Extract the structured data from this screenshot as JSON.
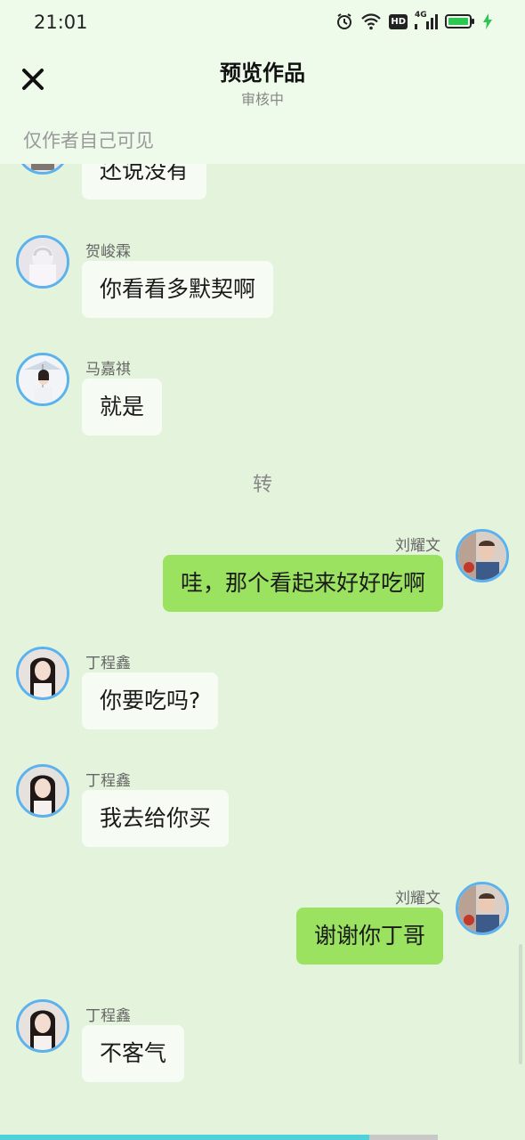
{
  "status_bar": {
    "time": "21:01",
    "icons": [
      "alarm-icon",
      "wifi-icon",
      "hd-icon",
      "signal-4g-icon",
      "battery-icon",
      "charging-icon"
    ],
    "hd_label": "HD",
    "network_label": "4G"
  },
  "header": {
    "title": "预览作品",
    "subtitle": "审核中",
    "notice": "仅作者自己可见",
    "close_icon": "close-icon"
  },
  "messages": [
    {
      "side": "left",
      "name": "",
      "text": "还说没有"
    },
    {
      "side": "left",
      "name": "贺峻霖",
      "text": "你看看多默契啊"
    },
    {
      "side": "left",
      "name": "马嘉祺",
      "text": "就是"
    },
    {
      "side": "divider",
      "text": "转"
    },
    {
      "side": "right",
      "name": "刘耀文",
      "text": "哇，那个看起来好好吃啊"
    },
    {
      "side": "left",
      "name": "丁程鑫",
      "text": "你要吃吗?"
    },
    {
      "side": "left",
      "name": "丁程鑫",
      "text": "我去给你买"
    },
    {
      "side": "right",
      "name": "刘耀文",
      "text": "谢谢你丁哥"
    },
    {
      "side": "left",
      "name": "丁程鑫",
      "text": "不客气"
    }
  ],
  "colors": {
    "background": "#e4f3dc",
    "header_bg": "#eefaea",
    "bubble_left": "#f6fcf3",
    "bubble_right": "#9be260",
    "avatar_border": "#5cb2ee"
  }
}
